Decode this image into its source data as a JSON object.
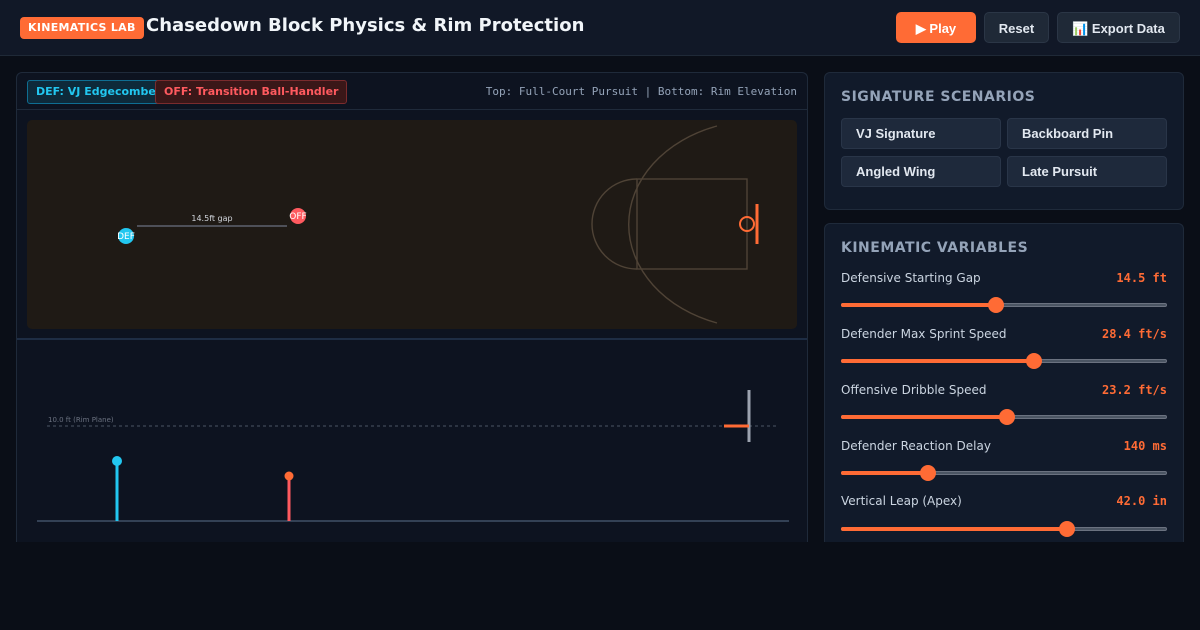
{
  "header": {
    "badge": "KINEMATICS LAB",
    "title": "Chasedown Block Physics & Rim Protection",
    "play_label": "▶ Play",
    "reset_label": "Reset",
    "export_label": "📊 Export Data"
  },
  "viz": {
    "defender_tag": "DEF: VJ Edgecombe",
    "offense_tag": "OFF: Transition Ball-Handler",
    "caption": "Top: Full-Court Pursuit | Bottom: Rim Elevation",
    "defender_marker": "DEF",
    "offense_marker": "OFF",
    "gap_label": "14.5ft gap",
    "rim_plane_label": "10.0 ft (Rim Plane)"
  },
  "scenarios": {
    "title": "SIGNATURE SCENARIOS",
    "items": [
      "VJ Signature",
      "Backboard Pin",
      "Angled Wing",
      "Late Pursuit"
    ]
  },
  "kinematics": {
    "title": "KINEMATIC VARIABLES",
    "variables": [
      {
        "label": "Defensive Starting Gap",
        "value": "14.5 ft",
        "fraction": 0.474
      },
      {
        "label": "Defender Max Sprint Speed",
        "value": "28.4 ft/s",
        "fraction": 0.592
      },
      {
        "label": "Offensive Dribble Speed",
        "value": "23.2 ft/s",
        "fraction": 0.509
      },
      {
        "label": "Defender Reaction Delay",
        "value": "140 ms",
        "fraction": 0.267
      },
      {
        "label": "Vertical Leap (Apex)",
        "value": "42.0 in",
        "fraction": 0.693
      }
    ]
  },
  "colors": {
    "accent": "#ff6b35",
    "defender": "#22c7f0",
    "offense": "#ff5a5f",
    "court": "#1f1a15"
  }
}
